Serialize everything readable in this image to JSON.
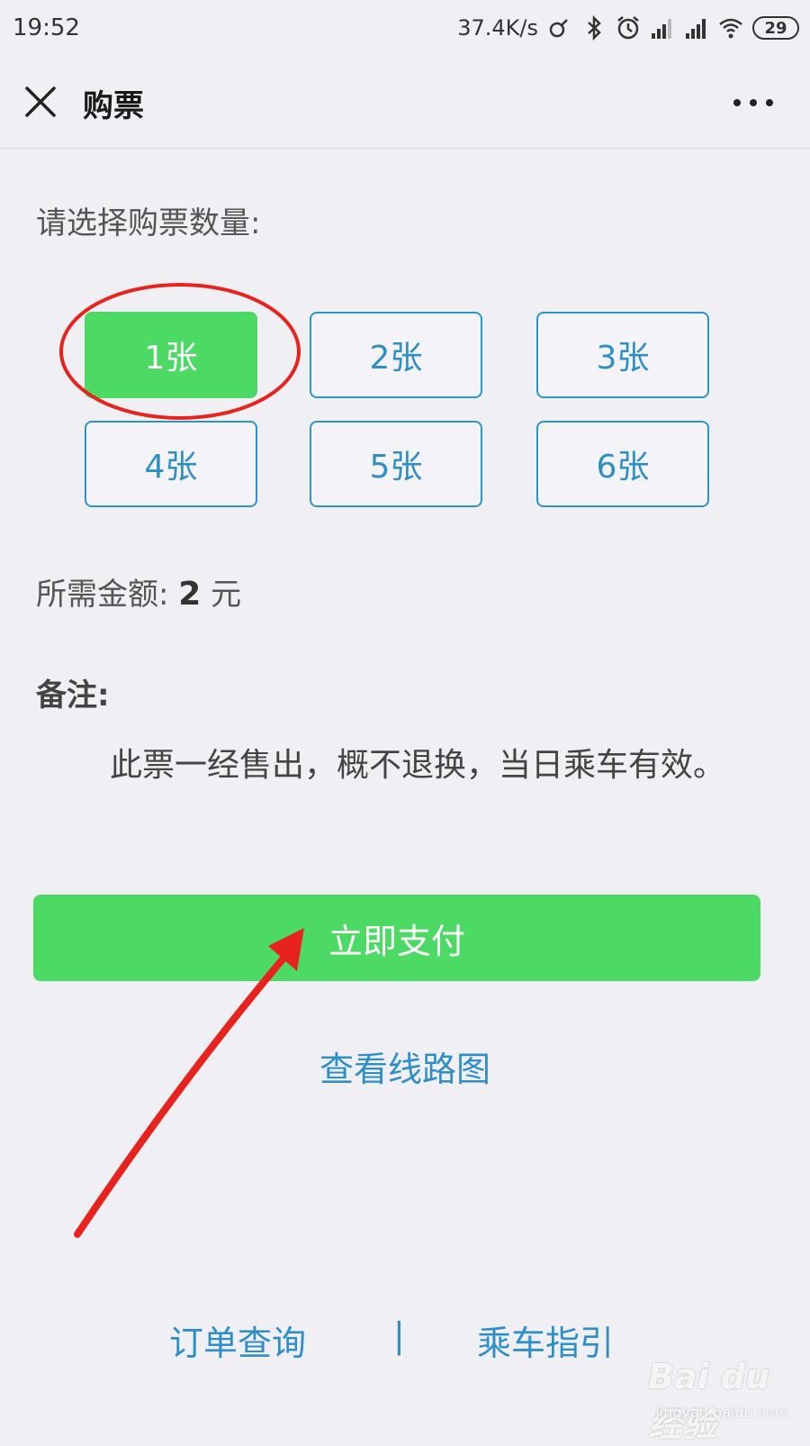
{
  "status_bar": {
    "time": "19:52",
    "net_speed": "37.4K/s",
    "battery": "29",
    "icons": [
      "link-icon",
      "bluetooth-icon",
      "alarm-icon",
      "signal-icon",
      "signal-icon",
      "wifi-icon",
      "battery-icon"
    ]
  },
  "nav": {
    "title": "购票",
    "close_icon": "close-icon",
    "more_icon": "more-icon"
  },
  "prompt": "请选择购票数量:",
  "tickets": [
    {
      "label": "1张",
      "selected": true
    },
    {
      "label": "2张",
      "selected": false
    },
    {
      "label": "3张",
      "selected": false
    },
    {
      "label": "4张",
      "selected": false
    },
    {
      "label": "5张",
      "selected": false
    },
    {
      "label": "6张",
      "selected": false
    }
  ],
  "amount": {
    "label": "所需金额:",
    "value": "2",
    "unit": "元"
  },
  "note": {
    "title": "备注:",
    "text": "此票一经售出，概不退换，当日乘车有效。"
  },
  "pay_button": "立即支付",
  "route_link": "查看线路图",
  "footer": {
    "order_query": "订单查询",
    "separator": "|",
    "ride_guide": "乘车指引"
  },
  "watermark": {
    "logo": "Bai du 经验",
    "url": "jingyan.baidu.com"
  },
  "colors": {
    "accent_green": "#4cd964",
    "link_blue": "#2e8fc6",
    "annotation_red": "#e8231d",
    "background": "#efeff4"
  }
}
